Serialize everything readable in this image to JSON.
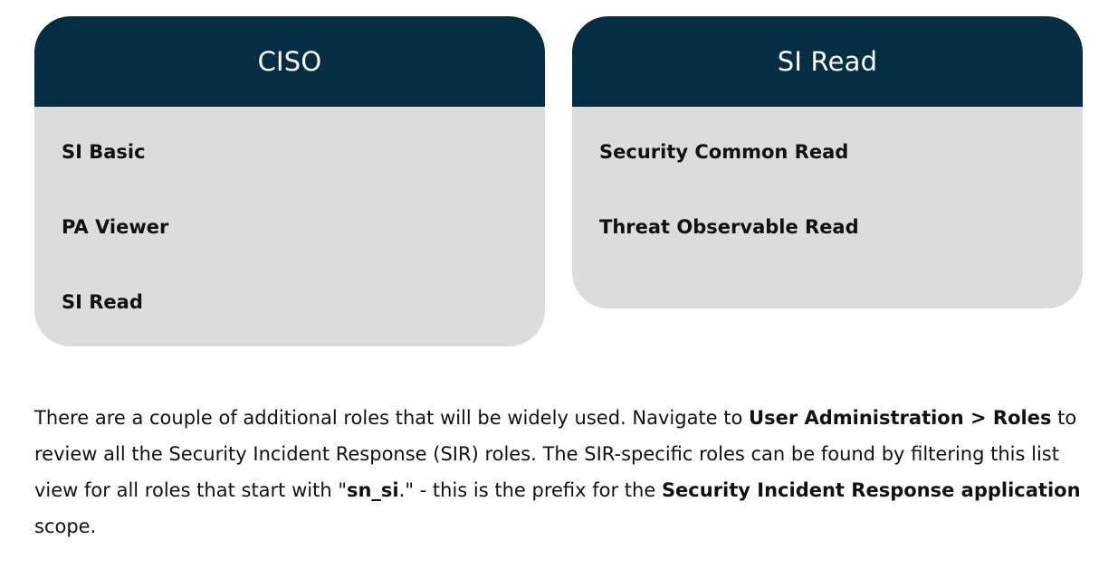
{
  "cards": [
    {
      "title": "CISO",
      "items": [
        "SI Basic",
        "PA Viewer",
        "SI Read"
      ]
    },
    {
      "title": "SI Read",
      "items": [
        "Security Common Read",
        "Threat Observable Read"
      ]
    }
  ],
  "paragraph": {
    "t1": "There are a couple of additional roles that will be widely used. Navigate to ",
    "b1": "User Administration > Roles",
    "t2": " to review all the Security Incident Response (SIR) roles. The SIR-specific roles can be found by filtering this list view for all roles that start with \"",
    "b2": "sn_si",
    "t3": ".\" - this is the prefix for the ",
    "b3": "Security Incident Response application",
    "t4": " scope."
  },
  "colors": {
    "header_bg": "#052d44",
    "card_bg": "#dcdcdc"
  }
}
